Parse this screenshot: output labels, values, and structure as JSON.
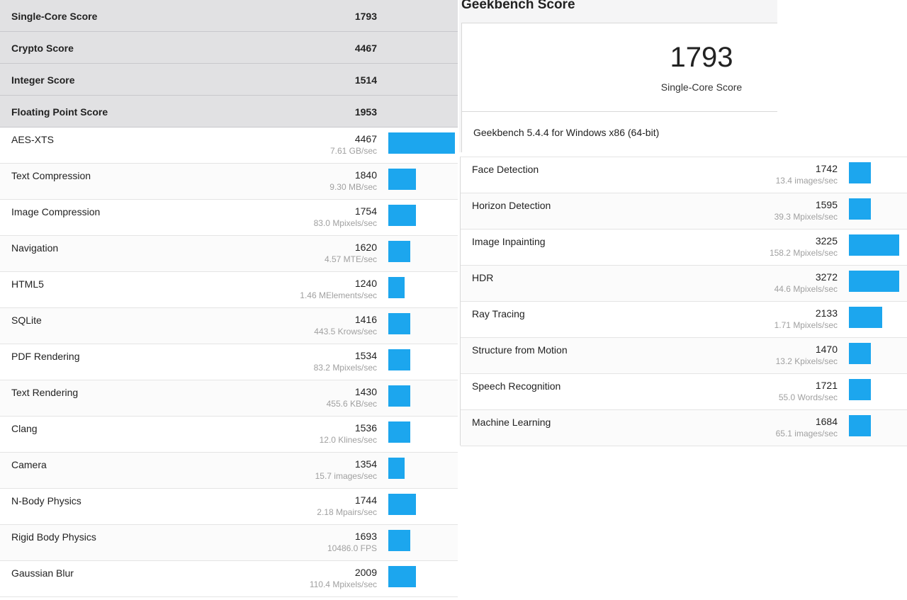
{
  "summary_sections": [
    {
      "name": "Single-Core Score",
      "score": "1793"
    },
    {
      "name": "Crypto Score",
      "score": "4467"
    },
    {
      "name": "Integer Score",
      "score": "1514"
    },
    {
      "name": "Floating Point Score",
      "score": "1953"
    }
  ],
  "left_benchmarks": [
    {
      "name": "AES-XTS",
      "score": "4467",
      "rate": "7.61 GB/sec",
      "bar_fraction": 0.94
    },
    {
      "name": "Text Compression",
      "score": "1840",
      "rate": "9.30 MB/sec",
      "bar_fraction": 0.39
    },
    {
      "name": "Image Compression",
      "score": "1754",
      "rate": "83.0 Mpixels/sec",
      "bar_fraction": 0.39
    },
    {
      "name": "Navigation",
      "score": "1620",
      "rate": "4.57 MTE/sec",
      "bar_fraction": 0.31
    },
    {
      "name": "HTML5",
      "score": "1240",
      "rate": "1.46 MElements/sec",
      "bar_fraction": 0.23
    },
    {
      "name": "SQLite",
      "score": "1416",
      "rate": "443.5 Krows/sec",
      "bar_fraction": 0.31
    },
    {
      "name": "PDF Rendering",
      "score": "1534",
      "rate": "83.2 Mpixels/sec",
      "bar_fraction": 0.31
    },
    {
      "name": "Text Rendering",
      "score": "1430",
      "rate": "455.6 KB/sec",
      "bar_fraction": 0.31
    },
    {
      "name": "Clang",
      "score": "1536",
      "rate": "12.0 Klines/sec",
      "bar_fraction": 0.31
    },
    {
      "name": "Camera",
      "score": "1354",
      "rate": "15.7 images/sec",
      "bar_fraction": 0.23
    },
    {
      "name": "N-Body Physics",
      "score": "1744",
      "rate": "2.18 Mpairs/sec",
      "bar_fraction": 0.39
    },
    {
      "name": "Rigid Body Physics",
      "score": "1693",
      "rate": "10486.0 FPS",
      "bar_fraction": 0.31
    },
    {
      "name": "Gaussian Blur",
      "score": "2009",
      "rate": "110.4 Mpixels/sec",
      "bar_fraction": 0.39
    }
  ],
  "right_header": {
    "title": "Geekbench Score",
    "big_score": "1793",
    "big_label": "Single-Core Score",
    "version": "Geekbench 5.4.4 for Windows x86 (64-bit)"
  },
  "right_benchmarks": [
    {
      "name": "Face Detection",
      "score": "1742",
      "rate": "13.4 images/sec",
      "bar_fraction": 0.31
    },
    {
      "name": "Horizon Detection",
      "score": "1595",
      "rate": "39.3 Mpixels/sec",
      "bar_fraction": 0.31
    },
    {
      "name": "Image Inpainting",
      "score": "3225",
      "rate": "158.2 Mpixels/sec",
      "bar_fraction": 0.71
    },
    {
      "name": "HDR",
      "score": "3272",
      "rate": "44.6 Mpixels/sec",
      "bar_fraction": 0.71
    },
    {
      "name": "Ray Tracing",
      "score": "2133",
      "rate": "1.71 Mpixels/sec",
      "bar_fraction": 0.47
    },
    {
      "name": "Structure from Motion",
      "score": "1470",
      "rate": "13.2 Kpixels/sec",
      "bar_fraction": 0.31
    },
    {
      "name": "Speech Recognition",
      "score": "1721",
      "rate": "55.0 Words/sec",
      "bar_fraction": 0.31
    },
    {
      "name": "Machine Learning",
      "score": "1684",
      "rate": "65.1 images/sec",
      "bar_fraction": 0.31
    }
  ],
  "colors": {
    "bar": "#1ca6ee",
    "section_bg": "#e1e1e3"
  }
}
